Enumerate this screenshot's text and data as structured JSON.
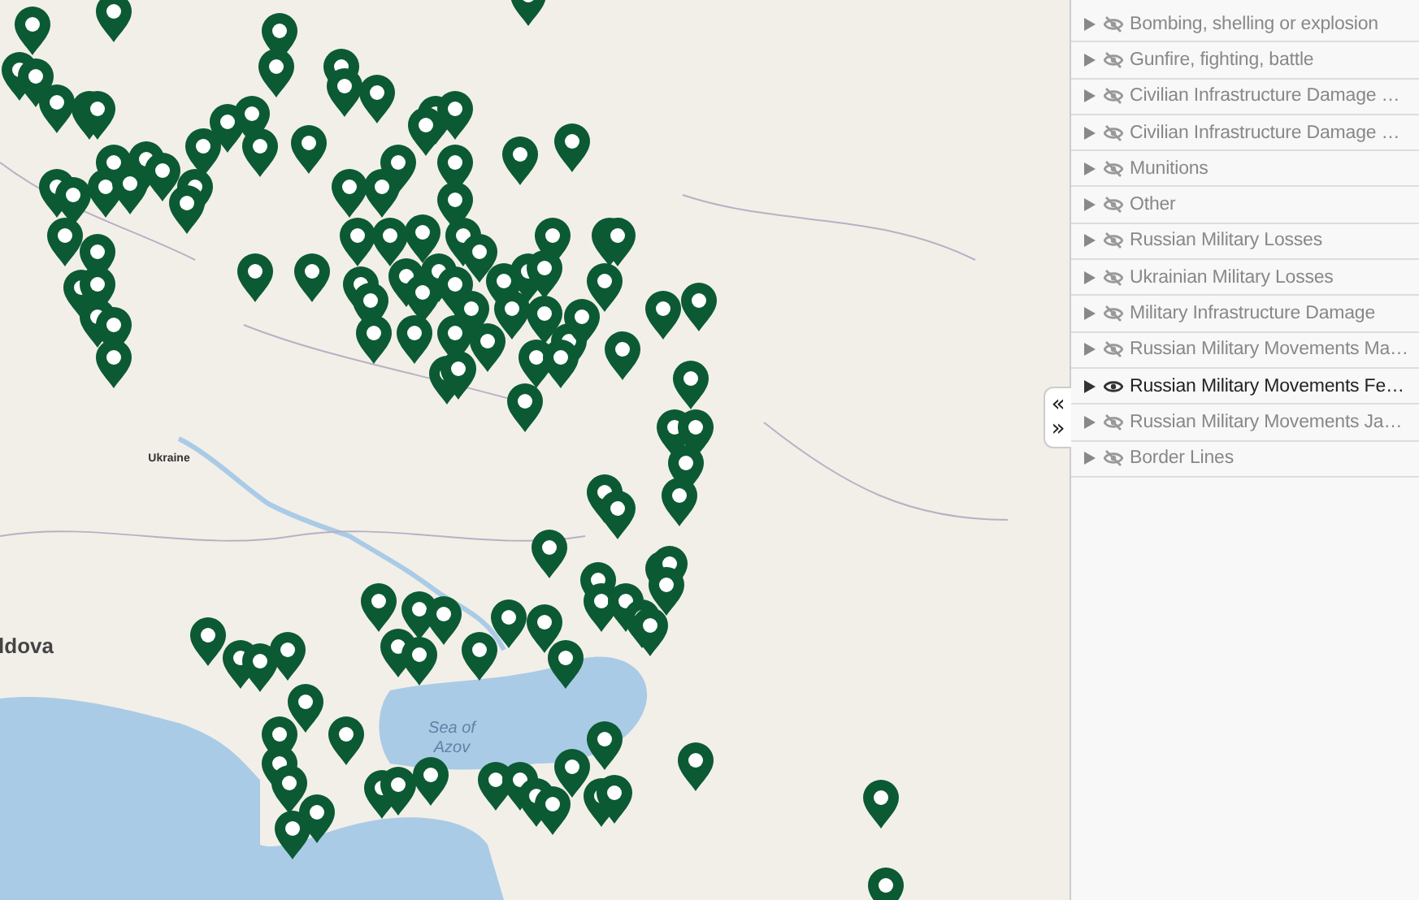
{
  "map": {
    "labels": [
      {
        "kind": "place",
        "text": "Ukraine"
      },
      {
        "kind": "country",
        "text": "ldova"
      },
      {
        "kind": "water",
        "text": "Sea of"
      },
      {
        "kind": "water",
        "text": "Azov"
      }
    ]
  },
  "layers_panel": {
    "collapse_toggle": {
      "icons": [
        "«",
        "»"
      ]
    },
    "layers": [
      {
        "label": "Bombing, shelling or explosion",
        "visible": false
      },
      {
        "label": "Gunfire, fighting, battle",
        "visible": false
      },
      {
        "label": "Civilian Infrastructure Damage …",
        "visible": false
      },
      {
        "label": "Civilian Infrastructure Damage …",
        "visible": false
      },
      {
        "label": "Munitions",
        "visible": false
      },
      {
        "label": "Other",
        "visible": false
      },
      {
        "label": "Russian Military Losses",
        "visible": false
      },
      {
        "label": "Ukrainian Military Losses",
        "visible": false
      },
      {
        "label": "Military Infrastructure Damage",
        "visible": false
      },
      {
        "label": "Russian Military Movements Ma…",
        "visible": false
      },
      {
        "label": "Russian Military Movements Fe…",
        "visible": true
      },
      {
        "label": "Russian Military Movements Ja…",
        "visible": false
      },
      {
        "label": "Border Lines",
        "visible": false
      }
    ]
  }
}
